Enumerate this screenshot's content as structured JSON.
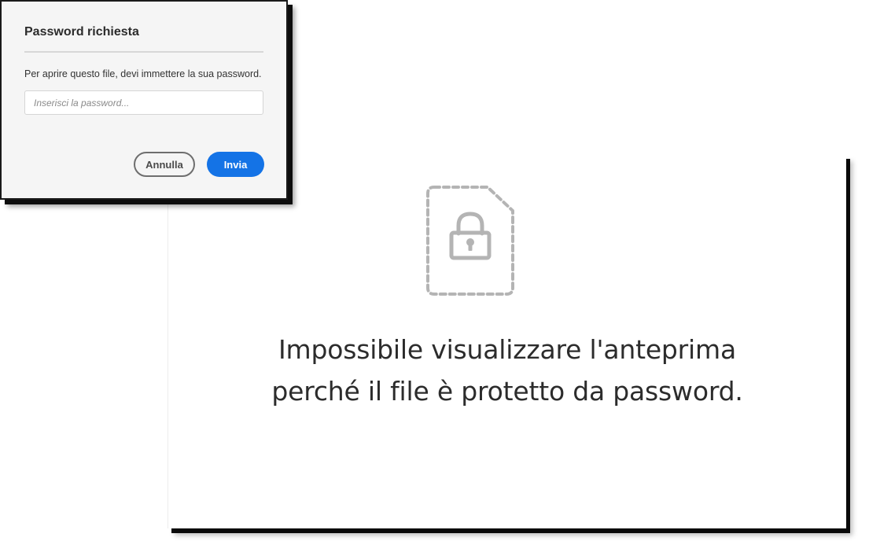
{
  "password_dialog": {
    "title": "Password richiesta",
    "message": "Per aprire questo file, devi immettere la sua password.",
    "input": {
      "placeholder": "Inserisci la password...",
      "value": ""
    },
    "cancel_label": "Annulla",
    "submit_label": "Invia",
    "accent_color": "#1473e6"
  },
  "preview": {
    "icon": "locked-file-icon",
    "message_line1": "Impossibile visualizzare l'anteprima",
    "message_line2": "perché il file è protetto da password."
  }
}
